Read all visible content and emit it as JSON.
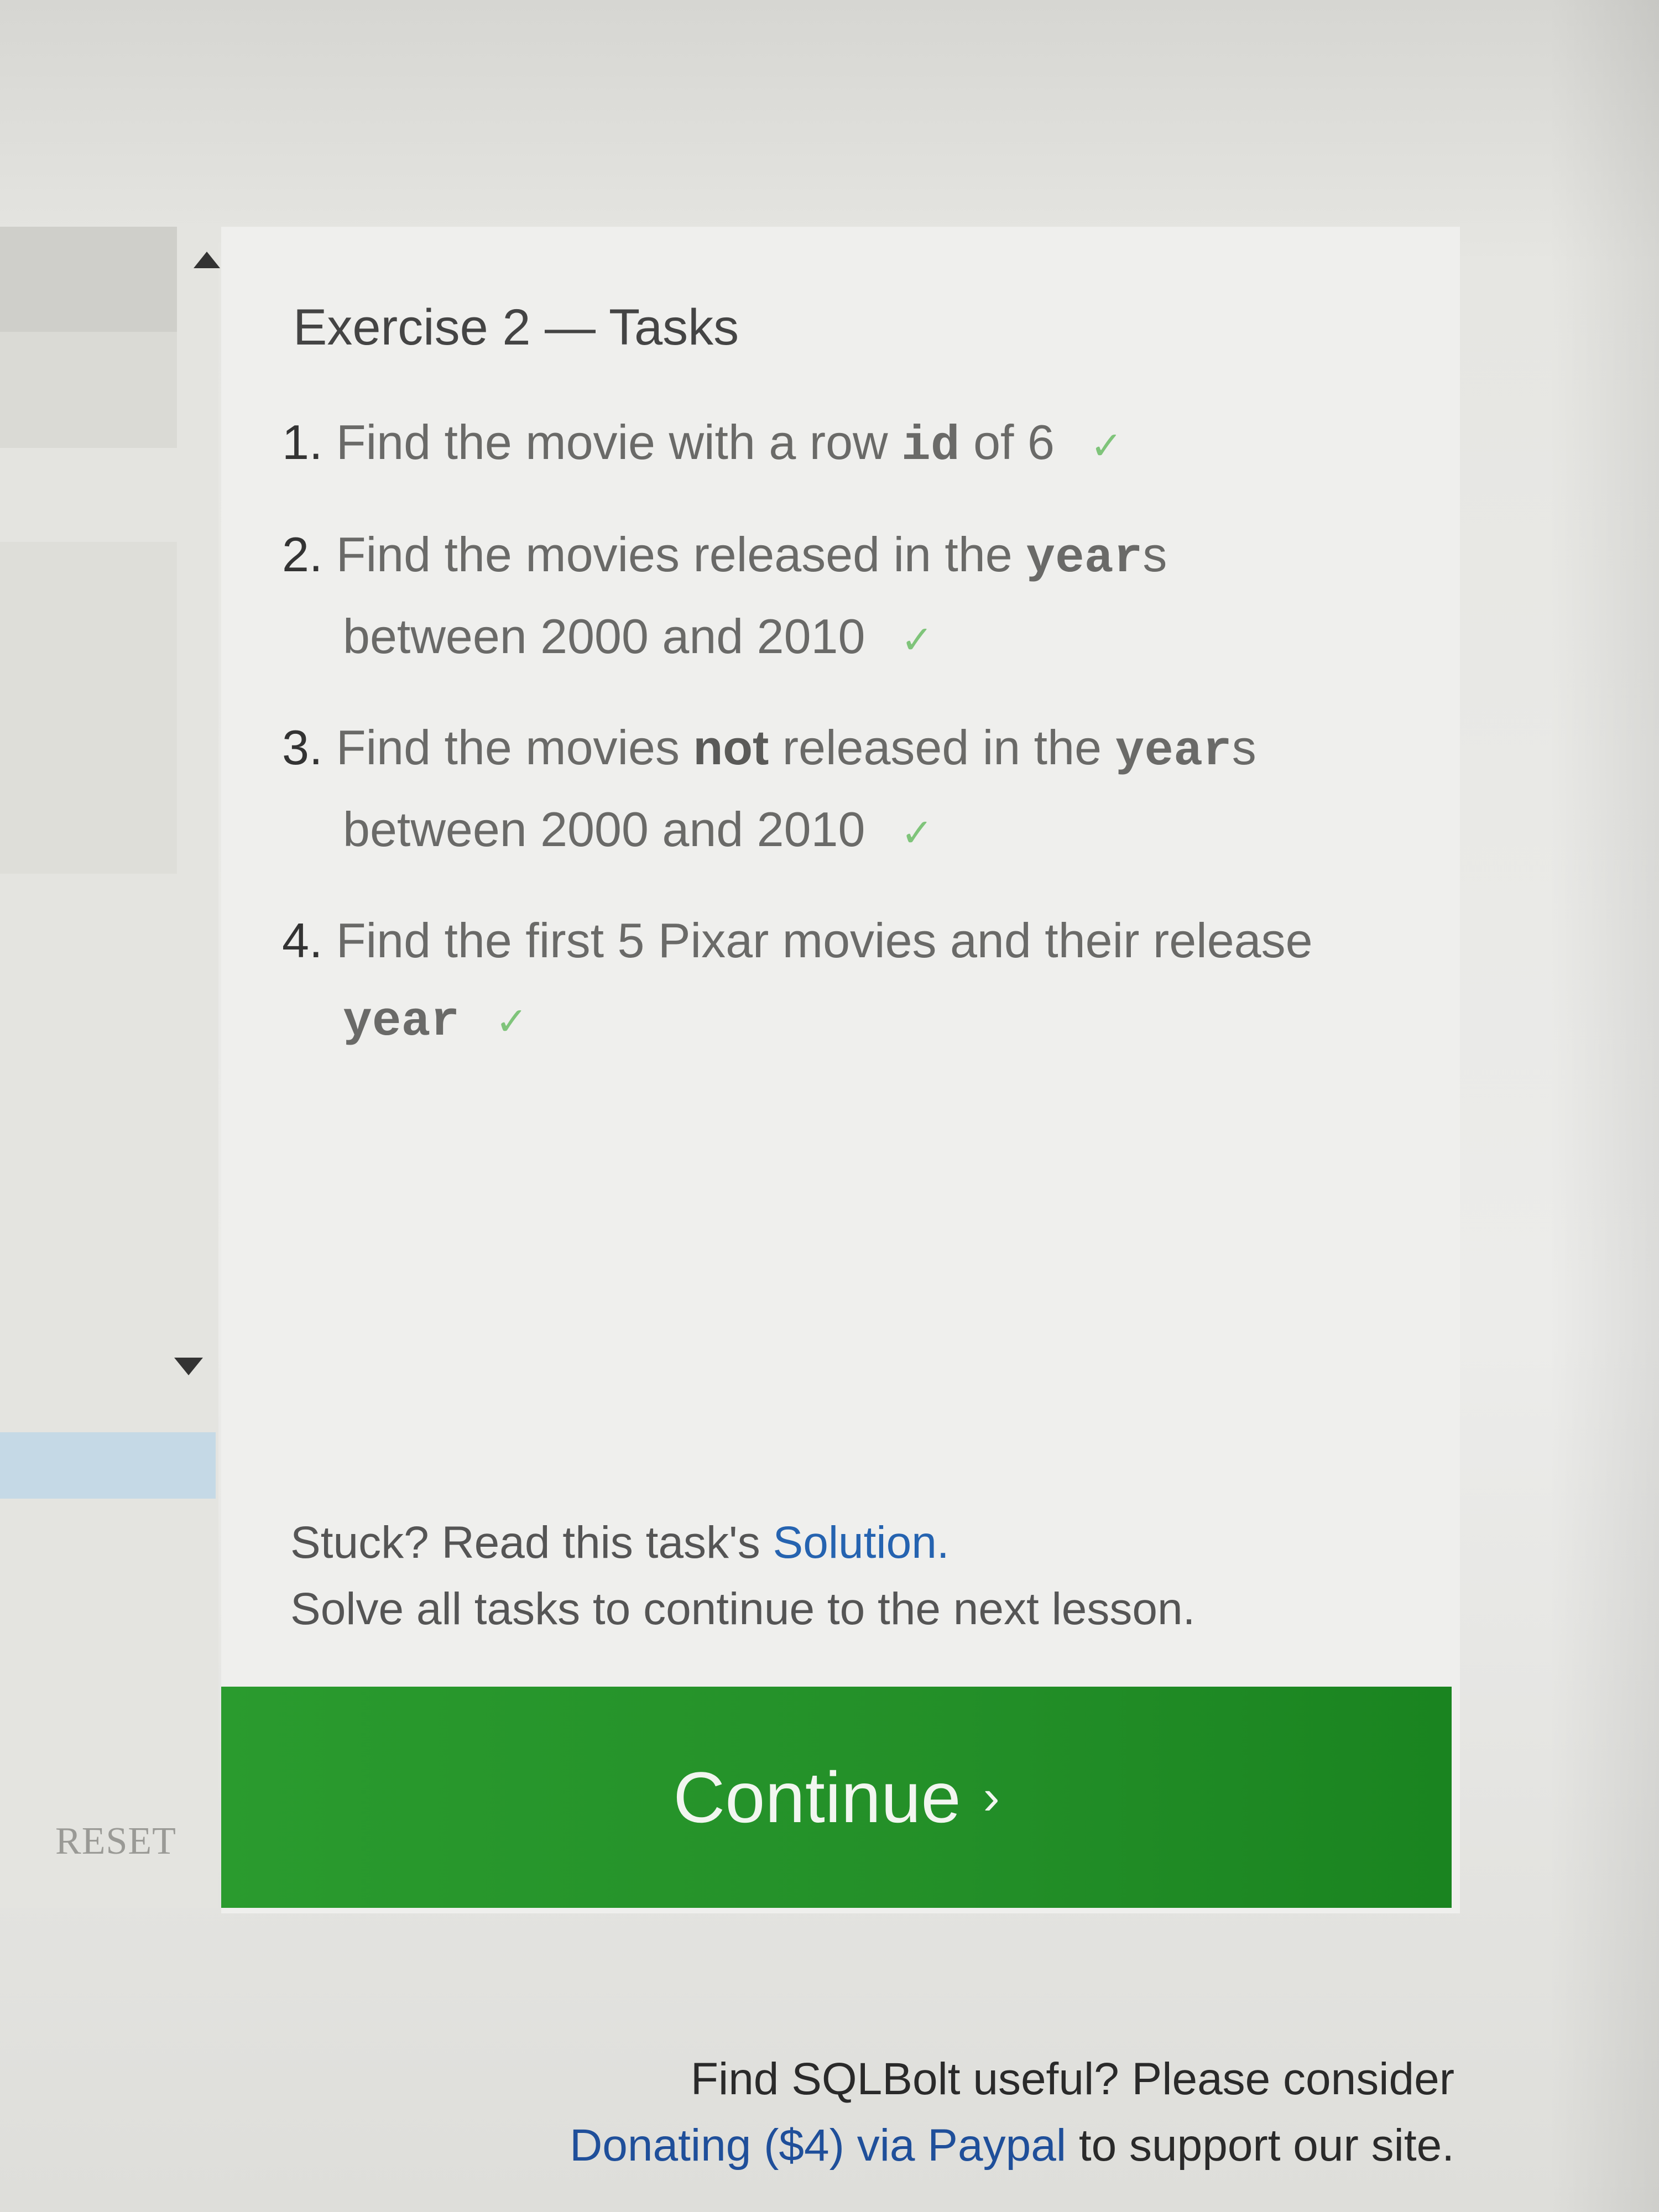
{
  "sidebar": {
    "reset_label": "RESET"
  },
  "exercise": {
    "title": "Exercise 2 — Tasks",
    "tasks": [
      {
        "num": "1.",
        "pre": "Find the movie with a row",
        "code": "id",
        "post": "of 6",
        "check": "✓"
      },
      {
        "num": "2.",
        "pre": "Find the movies released in the",
        "code": "year",
        "post": "s",
        "line2": "between 2000 and 2010",
        "check": "✓"
      },
      {
        "num": "3.",
        "pre": "Find the movies",
        "bold": "not",
        "mid": "released in the",
        "code": "year",
        "post": "s",
        "line2": "between 2000 and 2010",
        "check": "✓"
      },
      {
        "num": "4.",
        "pre": "Find the first 5 Pixar movies and their release",
        "code": "year",
        "check": "✓"
      }
    ]
  },
  "help": {
    "stuck_text": "Stuck? Read this task's",
    "solution_link": "Solution.",
    "continue_note": "Solve all tasks to continue to the next lesson."
  },
  "continue_button": {
    "label": "Continue",
    "chevron": "›"
  },
  "footer": {
    "line1": "Find SQLBolt useful? Please consider",
    "donate_link": "Donating ($4) via Paypal",
    "line2_suffix": "to support our site."
  },
  "colors": {
    "continue_green": "#2a9b2e",
    "check_green": "#7fc47a",
    "link_blue": "#2563b0"
  }
}
